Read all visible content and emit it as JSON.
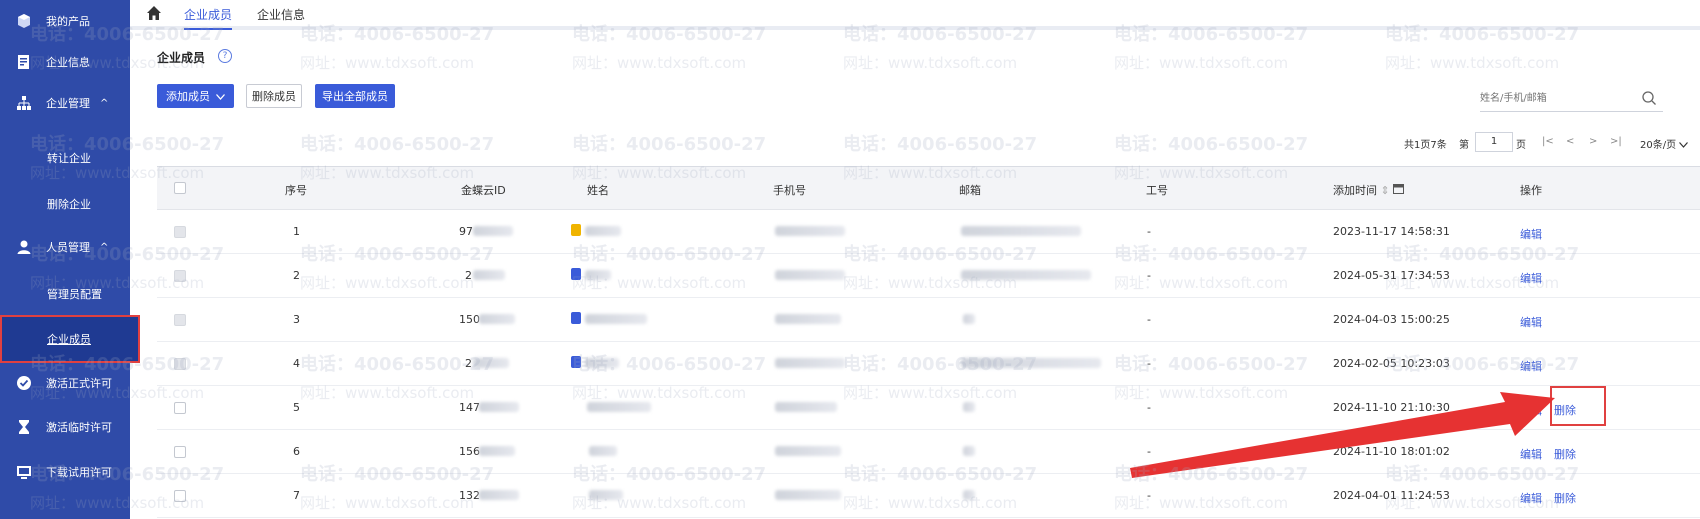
{
  "sidebar": {
    "items": [
      {
        "label": "我的产品"
      },
      {
        "label": "企业信息"
      },
      {
        "label": "企业管理",
        "caret": "^"
      },
      {
        "label": "人员管理",
        "caret": "^"
      },
      {
        "label": "激活正式许可"
      },
      {
        "label": "激活临时许可"
      },
      {
        "label": "下载试用许可"
      }
    ],
    "sub_items": [
      "转让企业",
      "删除企业",
      "管理员配置",
      "企业成员"
    ]
  },
  "topnav": {
    "tabs": [
      "企业成员",
      "企业信息"
    ]
  },
  "page": {
    "title": "企业成员",
    "help": "?"
  },
  "toolbar": {
    "add_label": "添加成员",
    "delete_label": "删除成员",
    "export_label": "导出全部成员"
  },
  "search": {
    "placeholder": "姓名/手机/邮箱"
  },
  "pager": {
    "summary": "共1页7条",
    "page_prefix": "第",
    "page_value": "1",
    "page_suffix": "页",
    "first": "|<",
    "prev": "<",
    "next": ">",
    "last": ">|",
    "page_size": "20条/页"
  },
  "table": {
    "headers": [
      "序号",
      "金蝶云ID",
      "姓名",
      "手机号",
      "邮箱",
      "工号",
      "添加时间",
      "操作"
    ],
    "sort_icon": "⇕",
    "rows": [
      {
        "index": "1",
        "id": "97",
        "emp": "-",
        "time": "2023-11-17 14:58:31",
        "ops": [
          "编辑"
        ]
      },
      {
        "index": "2",
        "id": "2",
        "emp": "-",
        "time": "2024-05-31 17:34:53",
        "ops": [
          "编辑"
        ]
      },
      {
        "index": "3",
        "id": "150",
        "emp": "-",
        "time": "2024-04-03 15:00:25",
        "ops": [
          "编辑"
        ]
      },
      {
        "index": "4",
        "id": "2",
        "emp": "-",
        "time": "2024-02-05 10:23:03",
        "ops": [
          "编辑"
        ]
      },
      {
        "index": "5",
        "id": "147",
        "emp": "-",
        "time": "2024-11-10 21:10:30",
        "ops": [
          "编辑",
          "删除"
        ]
      },
      {
        "index": "6",
        "id": "156",
        "emp": "-",
        "time": "2024-11-10 18:01:02",
        "ops": [
          "编辑",
          "删除"
        ]
      },
      {
        "index": "7",
        "id": "132",
        "emp": "-",
        "time": "2024-04-01 11:24:53",
        "ops": [
          "编辑",
          "删除"
        ]
      }
    ]
  },
  "watermark": {
    "phone": "电话：4006-6500-27",
    "site": "网址：www.tdxsoft.com"
  },
  "colors": {
    "sidebar": "#2f4ba8",
    "accent": "#3a5bd9",
    "highlight": "#e04040"
  }
}
